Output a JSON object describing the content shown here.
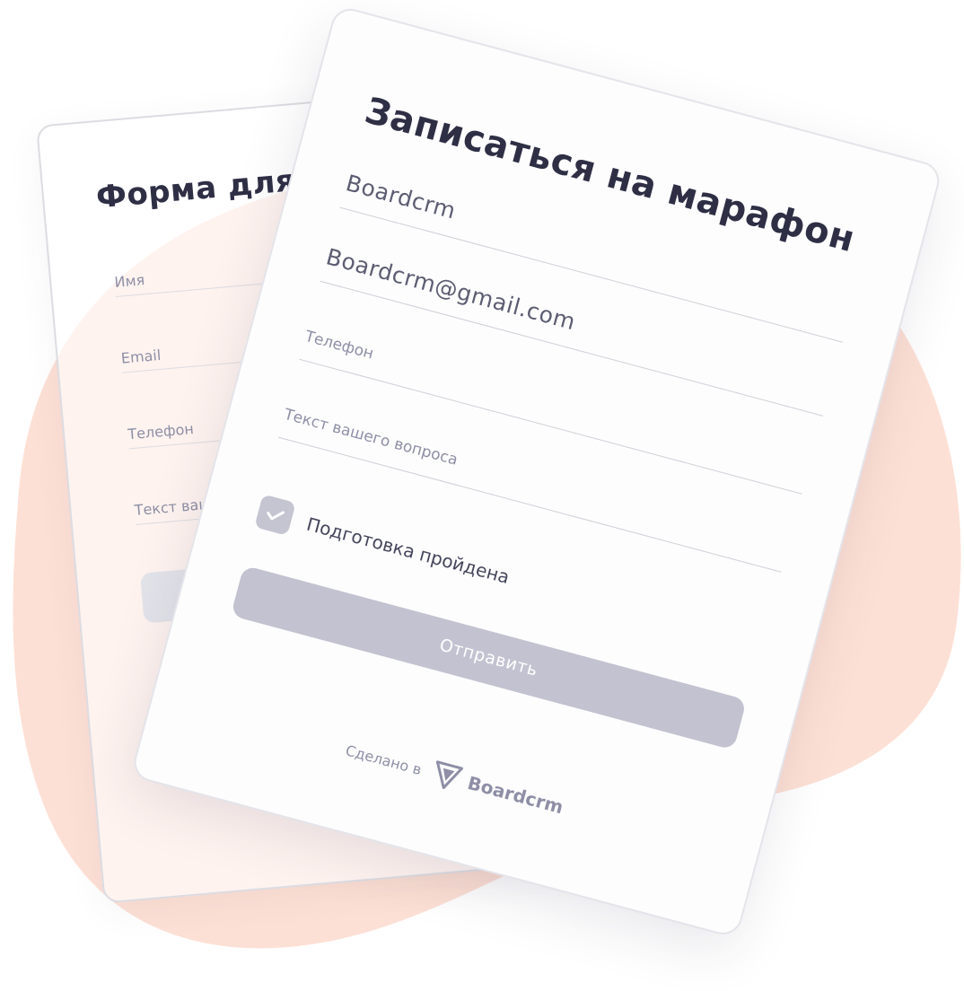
{
  "colors": {
    "blob": "#fde0d5",
    "title": "#2e2f45",
    "placeholder": "#8e8fa6",
    "button": "#c3c2d0",
    "checkbox": "#c5c4d1"
  },
  "back_form": {
    "title": "Форма для",
    "fields": [
      {
        "placeholder": "Имя"
      },
      {
        "placeholder": "Email"
      },
      {
        "placeholder": "Телефон"
      },
      {
        "placeholder": "Текст вашего вопроса"
      }
    ]
  },
  "front_form": {
    "title": "Записаться на марафон",
    "name_value": "Boardcrm",
    "email_value": "Boardcrm@gmail.com",
    "phone_placeholder": "Телефон",
    "question_placeholder": "Текст вашего вопроса",
    "checkbox": {
      "label": "Подготовка пройдена",
      "checked": true
    },
    "submit_label": "Отправить",
    "footer": {
      "made_in": "Сделано в",
      "brand": "Boardcrm",
      "logo_icon": "triangle-logo-icon"
    }
  }
}
